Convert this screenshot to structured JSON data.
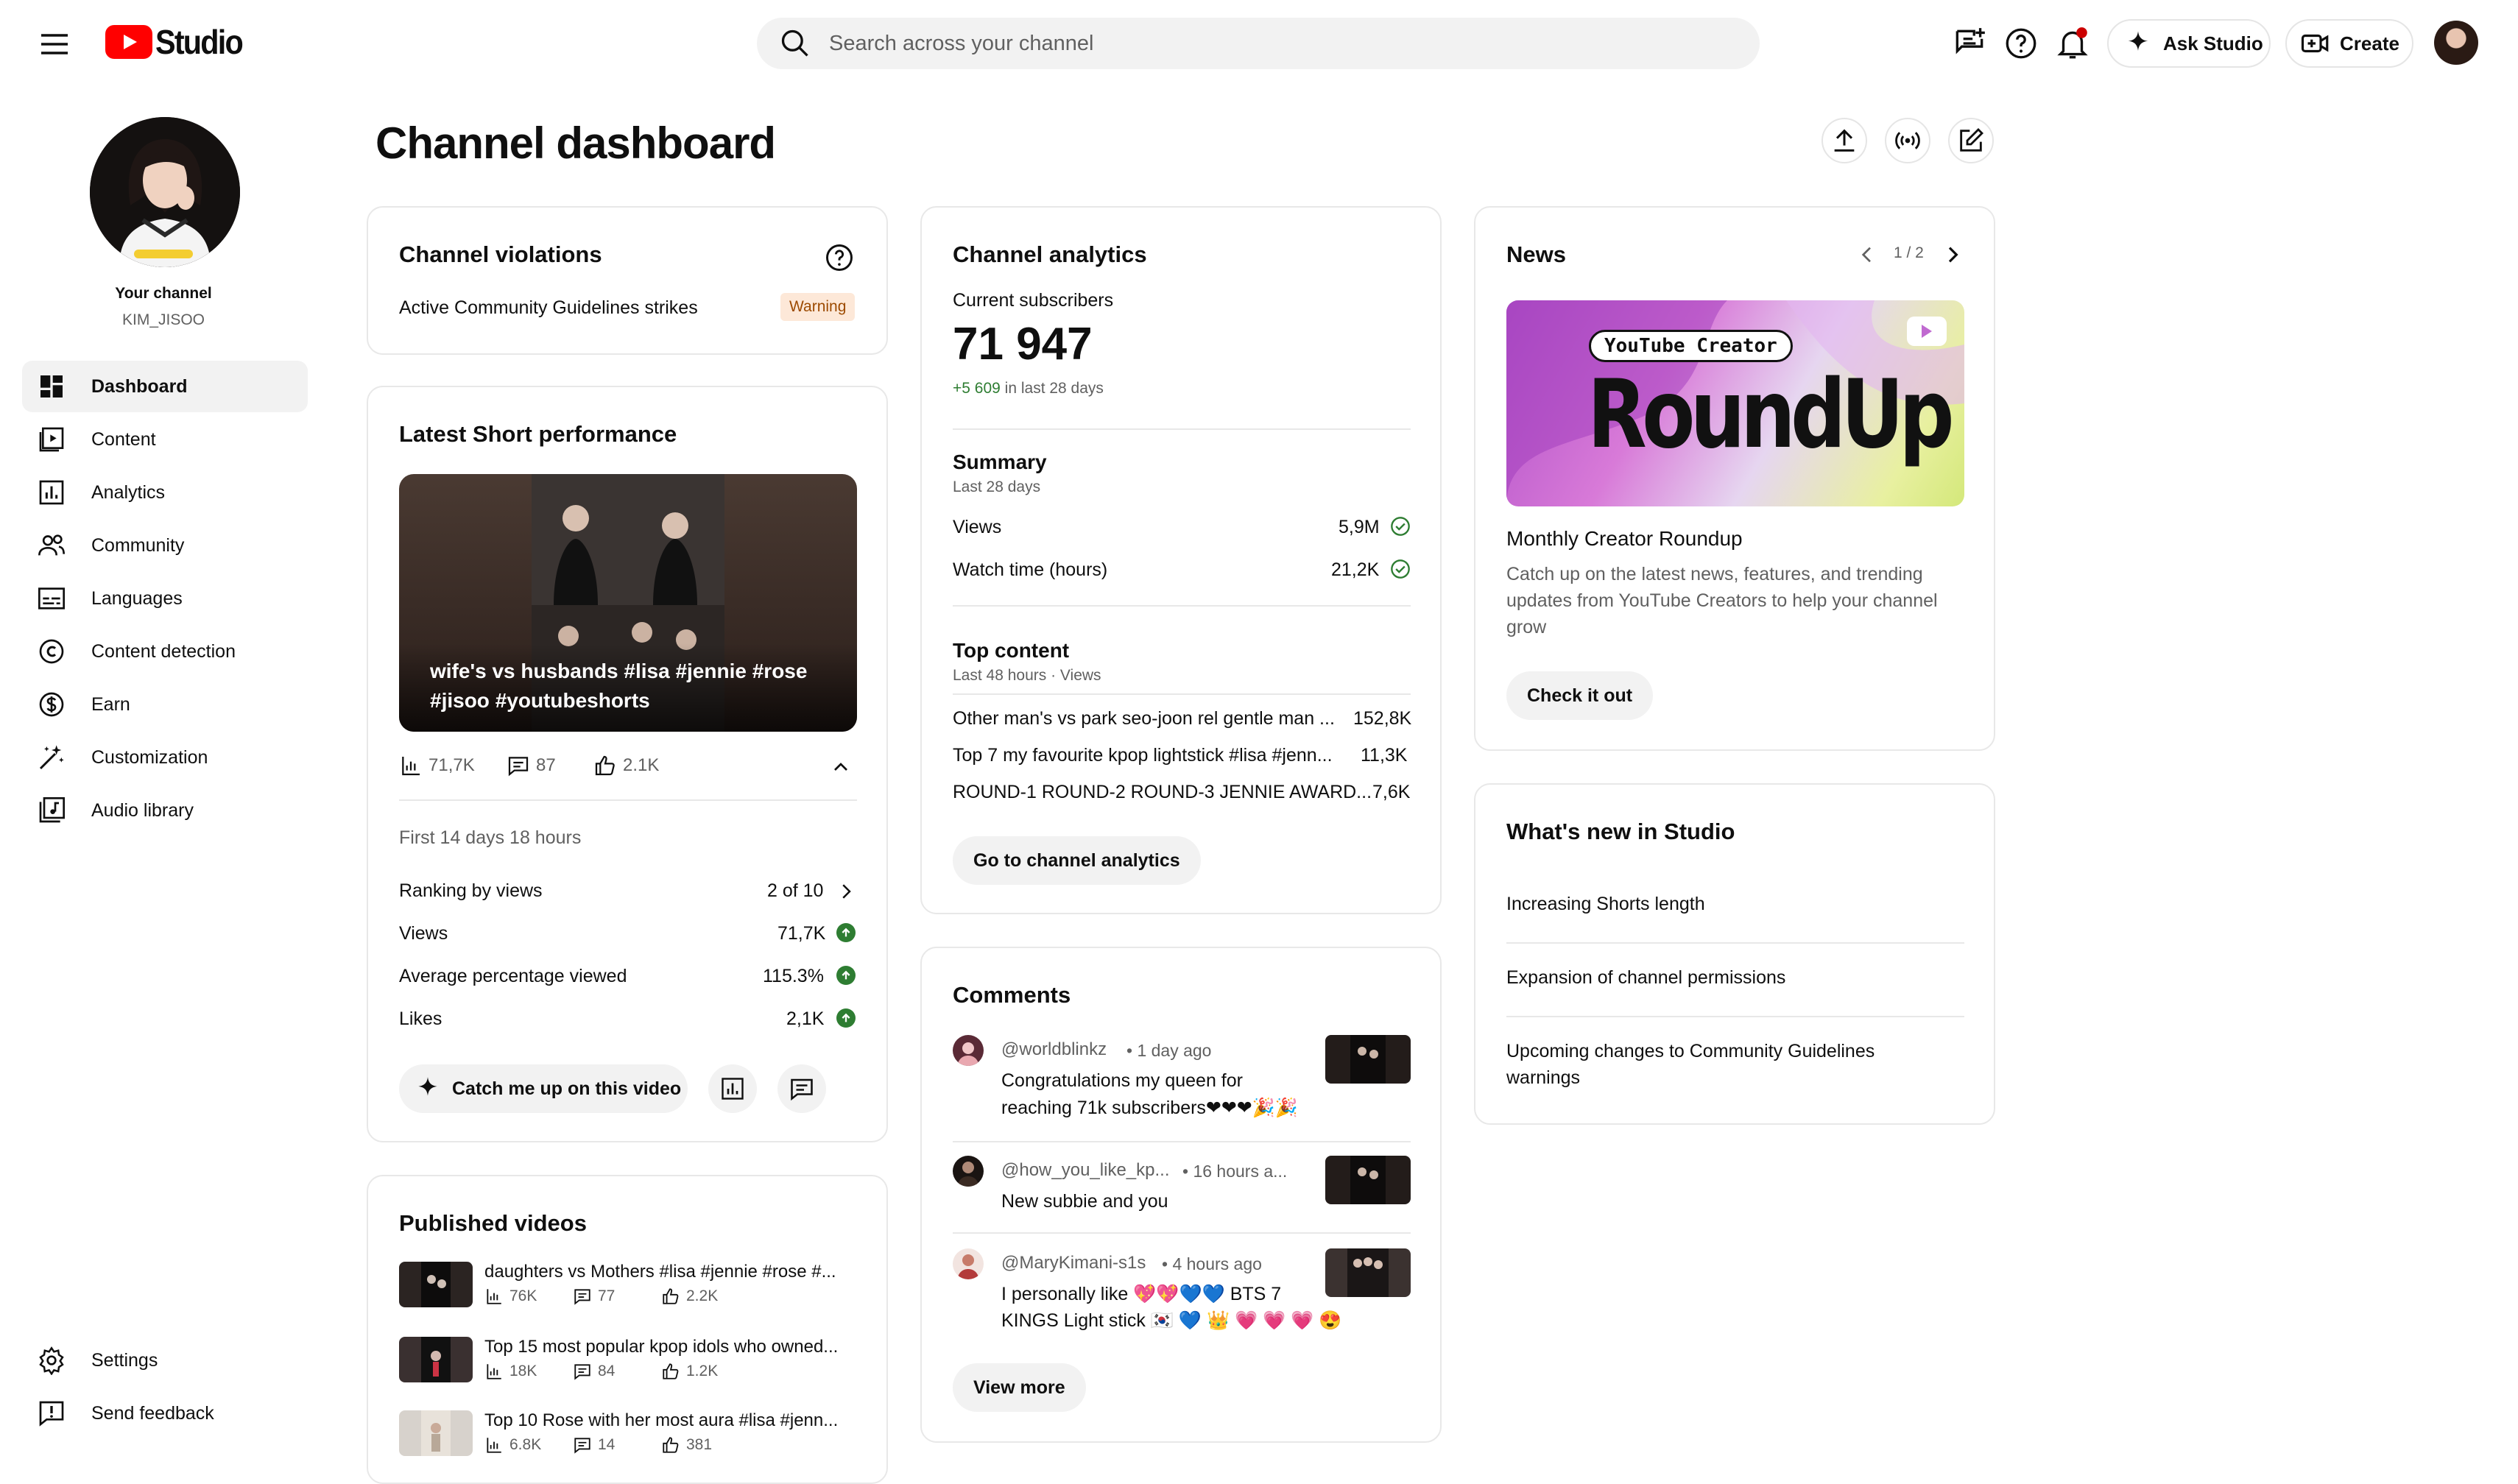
{
  "app": {
    "logo_text": "Studio",
    "brand_color": "#ff0000"
  },
  "search": {
    "placeholder": "Search across your channel"
  },
  "topbar": {
    "ask_studio": "Ask Studio",
    "create": "Create"
  },
  "channel": {
    "label": "Your channel",
    "name": "KIM_JISOO"
  },
  "sidebar": {
    "items": [
      {
        "label": "Dashboard",
        "icon": "dashboard-icon",
        "active": true
      },
      {
        "label": "Content",
        "icon": "content-icon"
      },
      {
        "label": "Analytics",
        "icon": "analytics-icon"
      },
      {
        "label": "Community",
        "icon": "community-icon"
      },
      {
        "label": "Languages",
        "icon": "languages-icon"
      },
      {
        "label": "Content detection",
        "icon": "copyright-icon"
      },
      {
        "label": "Earn",
        "icon": "dollar-icon"
      },
      {
        "label": "Customization",
        "icon": "magic-wand-icon"
      },
      {
        "label": "Audio library",
        "icon": "audio-library-icon"
      }
    ],
    "settings": "Settings",
    "feedback": "Send feedback"
  },
  "page": {
    "title": "Channel dashboard"
  },
  "violations": {
    "title": "Channel violations",
    "row": "Active Community Guidelines strikes",
    "badge": "Warning"
  },
  "short": {
    "title": "Latest Short performance",
    "video_title": "wife's vs husbands #lisa #jennie #rose #jisoo #youtubeshorts",
    "views": "71,7K",
    "comments": "87",
    "likes": "2.1K",
    "period": "First 14 days 18 hours",
    "rows": [
      {
        "label": "Ranking by views",
        "value": "2 of 10"
      },
      {
        "label": "Views",
        "value": "71,7K"
      },
      {
        "label": "Average percentage viewed",
        "value": "115.3%"
      },
      {
        "label": "Likes",
        "value": "2,1K"
      }
    ],
    "catch_up": "Catch me up on this video"
  },
  "published": {
    "title": "Published videos",
    "videos": [
      {
        "title": "daughters vs Mothers #lisa #jennie #rose #...",
        "views": "76K",
        "comments": "77",
        "likes": "2.2K"
      },
      {
        "title": "Top 15 most popular kpop idols who owned...",
        "views": "18K",
        "comments": "84",
        "likes": "1.2K"
      },
      {
        "title": "Top 10 Rose with her most aura #lisa #jenn...",
        "views": "6.8K",
        "comments": "14",
        "likes": "381"
      }
    ]
  },
  "analytics": {
    "title": "Channel analytics",
    "subs_label": "Current subscribers",
    "subs_value": "71 947",
    "subs_change": "+5 609",
    "subs_period": "in last 28 days",
    "summary_title": "Summary",
    "summary_period": "Last 28 days",
    "summary_rows": [
      {
        "label": "Views",
        "value": "5,9M"
      },
      {
        "label": "Watch time (hours)",
        "value": "21,2K"
      }
    ],
    "top_title": "Top content",
    "top_period": "Last 48 hours · Views",
    "top_rows": [
      {
        "label": "Other man's vs park seo-joon rel gentle man ...",
        "value": "152,8K"
      },
      {
        "label": "Top 7 my favourite kpop lightstick #lisa #jenn...",
        "value": "11,3K"
      },
      {
        "label": "ROUND-1 ROUND-2 ROUND-3 JENNIE AWARD...",
        "value": "7,6K"
      }
    ],
    "button": "Go to channel analytics"
  },
  "comments": {
    "title": "Comments",
    "items": [
      {
        "author": "@worldblinkz",
        "time": "• 1 day ago",
        "text1": "Congratulations my queen for",
        "text2": "reaching 71k subscribers❤❤❤🎉🎉"
      },
      {
        "author": "@how_you_like_kp...",
        "time": "• 16 hours a...",
        "text1": "New subbie and you",
        "text2": ""
      },
      {
        "author": "@MaryKimani-s1s",
        "time": "• 4 hours ago",
        "text1": "I personally like 💖💖💙💙 BTS 7",
        "text2": "KINGS Light stick 🇰🇷 💙 👑 💗 💗 💗 😍"
      }
    ],
    "view_more": "View more"
  },
  "news": {
    "title": "News",
    "pager": "1 / 2",
    "banner_tag": "YouTube Creator",
    "banner_title": "RoundUp",
    "headline": "Monthly Creator Roundup",
    "body1": "Catch up on the latest news, features, and trending",
    "body2": "updates from YouTube Creators to help your channel",
    "body3": "grow",
    "button": "Check it out"
  },
  "whats_new": {
    "title": "What's new in Studio",
    "items": [
      "Increasing Shorts length",
      "Expansion of channel permissions",
      "Upcoming changes to Community Guidelines",
      "warnings"
    ]
  },
  "colors": {
    "green": "#2e7d32",
    "warning_bg": "#fde8d8",
    "warning_text": "#9c4a00",
    "notification": "#cc0000"
  }
}
